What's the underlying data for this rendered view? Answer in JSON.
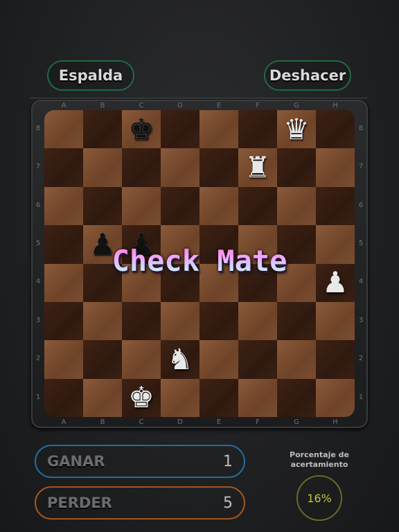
{
  "header": {
    "back_label": "Espalda",
    "undo_label": "Deshacer"
  },
  "board": {
    "files": [
      "A",
      "B",
      "C",
      "D",
      "E",
      "F",
      "G",
      "H"
    ],
    "ranks": [
      "8",
      "7",
      "6",
      "5",
      "4",
      "3",
      "2",
      "1"
    ],
    "pieces": [
      {
        "square": "c8",
        "color": "black",
        "type": "king",
        "glyph": "♚"
      },
      {
        "square": "g8",
        "color": "white",
        "type": "queen",
        "glyph": "♛"
      },
      {
        "square": "f7",
        "color": "white",
        "type": "rook",
        "glyph": "♜"
      },
      {
        "square": "b5",
        "color": "black",
        "type": "pawn",
        "glyph": "♟"
      },
      {
        "square": "c5",
        "color": "black",
        "type": "pawn",
        "glyph": "♟"
      },
      {
        "square": "h4",
        "color": "white",
        "type": "pawn",
        "glyph": "♟"
      },
      {
        "square": "d2",
        "color": "white",
        "type": "knight",
        "glyph": "♞"
      },
      {
        "square": "c1",
        "color": "white",
        "type": "king",
        "glyph": "♚"
      }
    ]
  },
  "overlay": {
    "text": "Check Mate"
  },
  "stats": {
    "win_label": "GANAR",
    "win_value": "1",
    "lose_label": "PERDER",
    "lose_value": "5",
    "pct_label": "Porcentaje de acertamiento",
    "pct_value": "16%"
  }
}
